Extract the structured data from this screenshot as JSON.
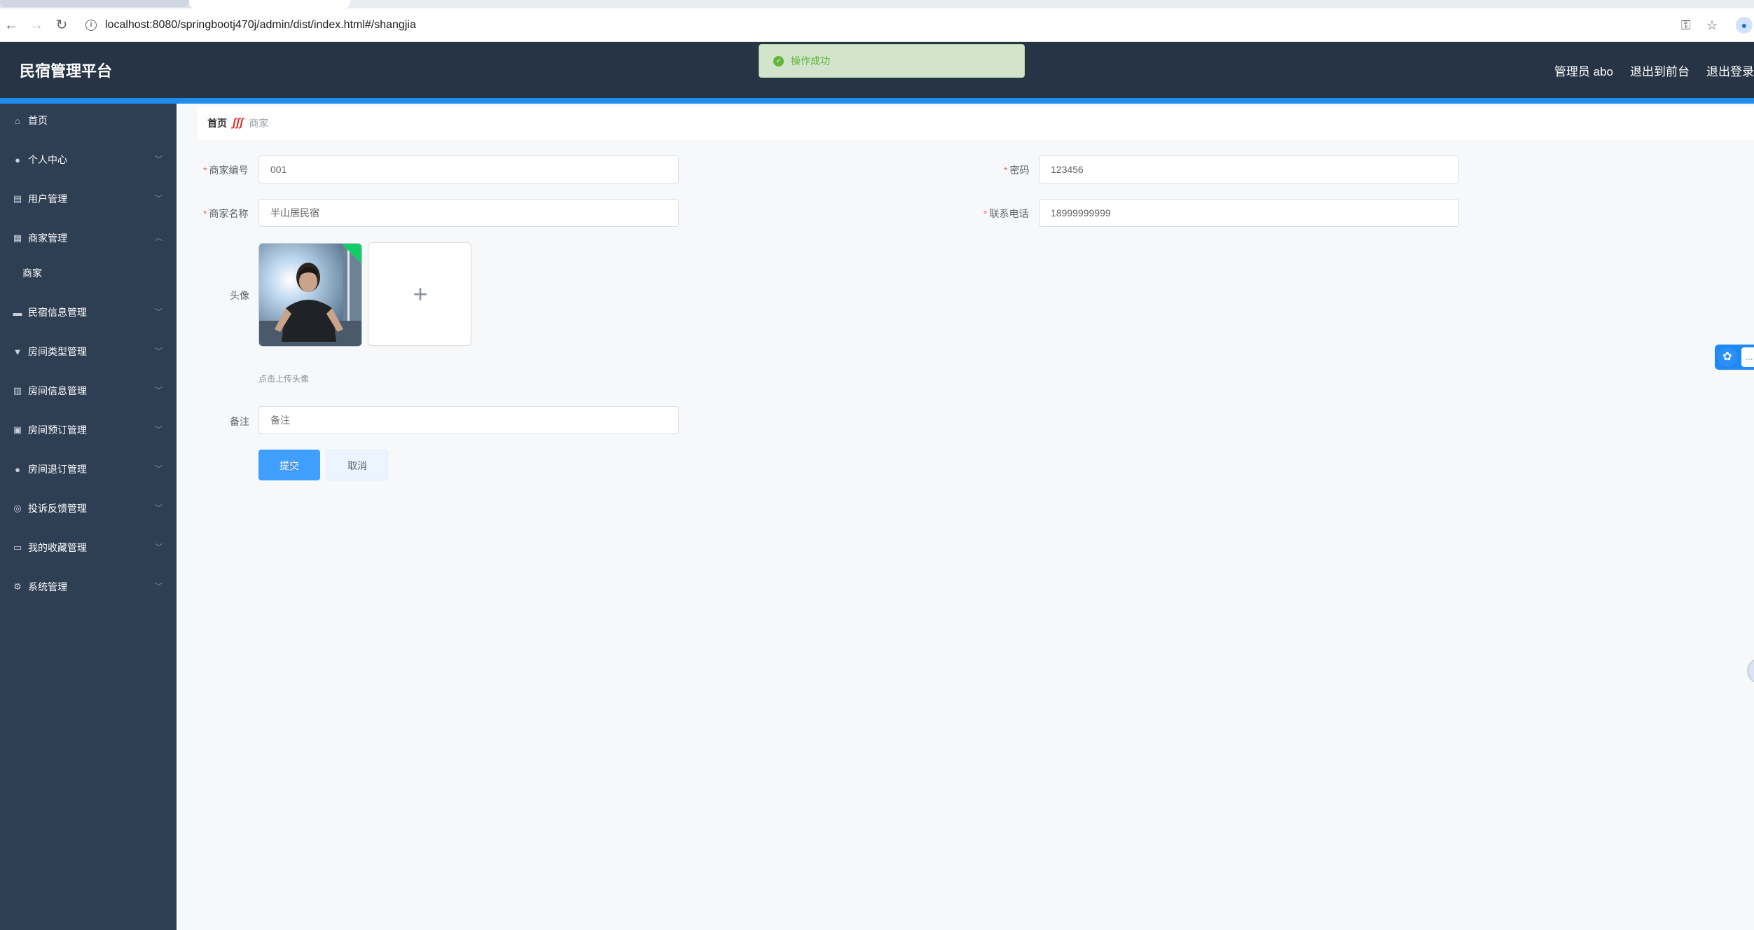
{
  "browser": {
    "url": "localhost:8080/springbootj470j/admin/dist/index.html#/shangjia"
  },
  "header": {
    "title": "民宿管理平台",
    "user": "管理员 abo",
    "to_front": "退出到前台",
    "logout": "退出登录"
  },
  "toast": {
    "message": "操作成功"
  },
  "sidebar": {
    "items": [
      {
        "label": "首页",
        "icon": "home-icon",
        "has_children": false
      },
      {
        "label": "个人中心",
        "icon": "user-icon",
        "has_children": true
      },
      {
        "label": "用户管理",
        "icon": "briefcase-icon",
        "has_children": true
      },
      {
        "label": "商家管理",
        "icon": "clipboard-icon",
        "has_children": true,
        "expanded": true,
        "children": [
          "商家"
        ]
      },
      {
        "label": "民宿信息管理",
        "icon": "bed-icon",
        "has_children": true
      },
      {
        "label": "房间类型管理",
        "icon": "tag-icon",
        "has_children": true
      },
      {
        "label": "房间信息管理",
        "icon": "chart-icon",
        "has_children": true
      },
      {
        "label": "房间预订管理",
        "icon": "document-icon",
        "has_children": true
      },
      {
        "label": "房间退订管理",
        "icon": "person-icon",
        "has_children": true
      },
      {
        "label": "投诉反馈管理",
        "icon": "compass-icon",
        "has_children": true
      },
      {
        "label": "我的收藏管理",
        "icon": "book-icon",
        "has_children": true
      },
      {
        "label": "系统管理",
        "icon": "gear-icon",
        "has_children": true
      }
    ]
  },
  "breadcrumb": {
    "home": "首页",
    "current": "商家"
  },
  "form": {
    "merchant_no_label": "商家编号",
    "merchant_no_value": "001",
    "password_label": "密码",
    "password_value": "123456",
    "merchant_name_label": "商家名称",
    "merchant_name_value": "半山居民宿",
    "phone_label": "联系电话",
    "phone_value": "18999999999",
    "avatar_label": "头像",
    "avatar_tip": "点击上传头像",
    "remark_label": "备注",
    "remark_placeholder": "备注",
    "submit_label": "提交",
    "cancel_label": "取消"
  },
  "colors": {
    "header_bg": "#263446",
    "sidebar_bg": "#2e3e53",
    "accent": "#1e8cf0",
    "primary_button": "#409eff",
    "success": "#67c23a"
  }
}
